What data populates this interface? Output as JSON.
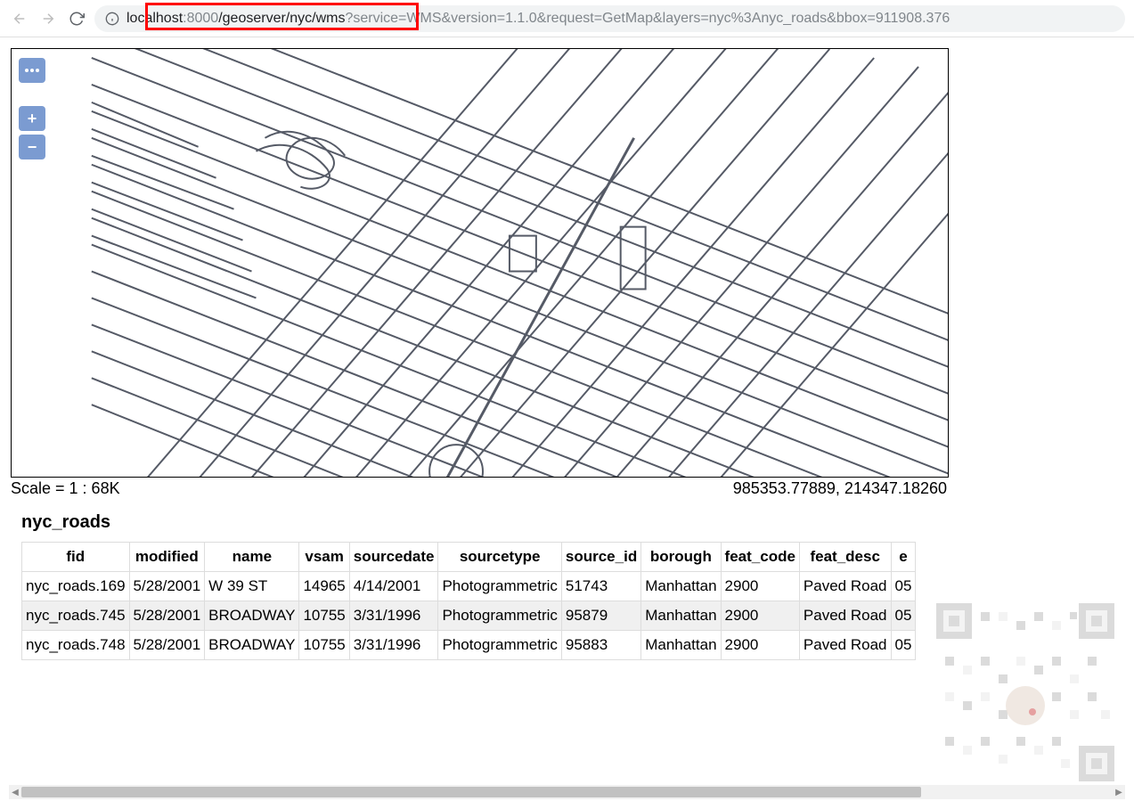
{
  "browser": {
    "url_host": "localhost",
    "url_port": ":8000",
    "url_path": "/geoserver/nyc/wms",
    "url_query": "?service=WMS&version=1.1.0&request=GetMap&layers=nyc%3Anyc_roads&bbox=911908.376"
  },
  "map": {
    "scale_label": "Scale = 1 : 68K",
    "coords": "985353.77889, 214347.18260"
  },
  "table": {
    "title": "nyc_roads",
    "columns": [
      "fid",
      "modified",
      "name",
      "vsam",
      "sourcedate",
      "sourcetype",
      "source_id",
      "borough",
      "feat_code",
      "feat_desc",
      "e"
    ],
    "rows": [
      {
        "fid": "nyc_roads.169",
        "modified": "5/28/2001",
        "name": "W 39 ST",
        "vsam": "14965",
        "sourcedate": "4/14/2001",
        "sourcetype": "Photogrammetric",
        "source_id": "51743",
        "borough": "Manhattan",
        "feat_code": "2900",
        "feat_desc": "Paved Road",
        "e": "05"
      },
      {
        "fid": "nyc_roads.745",
        "modified": "5/28/2001",
        "name": "BROADWAY",
        "vsam": "10755",
        "sourcedate": "3/31/1996",
        "sourcetype": "Photogrammetric",
        "source_id": "95879",
        "borough": "Manhattan",
        "feat_code": "2900",
        "feat_desc": "Paved Road",
        "e": "05"
      },
      {
        "fid": "nyc_roads.748",
        "modified": "5/28/2001",
        "name": "BROADWAY",
        "vsam": "10755",
        "sourcedate": "3/31/1996",
        "sourcetype": "Photogrammetric",
        "source_id": "95883",
        "borough": "Manhattan",
        "feat_code": "2900",
        "feat_desc": "Paved Road",
        "e": "05"
      }
    ]
  }
}
